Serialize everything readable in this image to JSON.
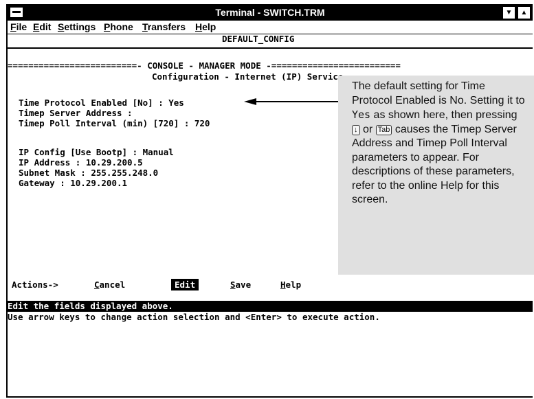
{
  "window": {
    "title": "Terminal - SWITCH.TRM"
  },
  "menu": [
    {
      "pre": "",
      "u": "F",
      "post": "ile"
    },
    {
      "pre": "",
      "u": "E",
      "post": "dit"
    },
    {
      "pre": "",
      "u": "S",
      "post": "ettings"
    },
    {
      "pre": "",
      "u": "P",
      "post": "hone"
    },
    {
      "pre": "",
      "u": "T",
      "post": "ransfers"
    },
    {
      "pre": "",
      "u": "H",
      "post": "elp"
    }
  ],
  "screen": {
    "config_name": "DEFAULT_CONFIG",
    "mode_line": "=========================- CONSOLE - MANAGER MODE -=========================",
    "subtitle": "Configuration - Internet (IP) Service",
    "fields": [
      "Time Protocol Enabled [No] : Yes",
      "Timep Server Address :",
      "Timep Poll Interval (min) [720] : 720",
      "IP Config [Use Bootp] : Manual",
      "IP Address : 10.29.200.5",
      "Subnet Mask : 255.255.248.0",
      "Gateway : 10.29.200.1"
    ],
    "actions_label": "Actions->",
    "actions": {
      "cancel_u": "C",
      "cancel_rest": "ancel",
      "edit": "Edit",
      "save_u": "S",
      "save_rest": "ave",
      "help_u": "H",
      "help_rest": "elp"
    },
    "status_line": "Edit the fields displayed above.",
    "hint_line": "Use arrow keys to change action selection and <Enter> to execute action."
  },
  "callout": {
    "text_a": "The default setting for Time Protocol Enabled is No. Setting it to ",
    "code": "Yes",
    "text_b": " as shown here, then pressing ",
    "key1": "↓",
    "text_c": " or ",
    "key2": "Tab",
    "text_d": " causes the Timep Server Address and Timep Poll Interval parameters to appear. For descriptions of these parameters, refer to the online Help for this screen."
  }
}
